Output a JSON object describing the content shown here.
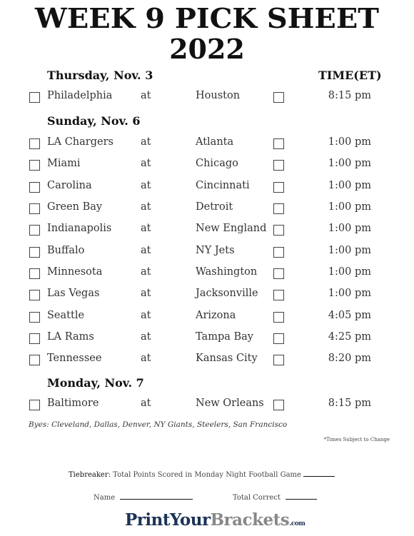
{
  "title": {
    "line1": "WEEK 9 PICK SHEET",
    "line2": "2022"
  },
  "time_header": "TIME(ET)",
  "at_label": "at",
  "days": [
    {
      "label": "Thursday, Nov. 3",
      "games": [
        {
          "away": "Philadelphia",
          "home": "Houston",
          "time": "8:15 pm"
        }
      ]
    },
    {
      "label": "Sunday, Nov. 6",
      "games": [
        {
          "away": "LA Chargers",
          "home": "Atlanta",
          "time": "1:00 pm"
        },
        {
          "away": "Miami",
          "home": "Chicago",
          "time": "1:00 pm"
        },
        {
          "away": "Carolina",
          "home": "Cincinnati",
          "time": "1:00 pm"
        },
        {
          "away": "Green Bay",
          "home": "Detroit",
          "time": "1:00 pm"
        },
        {
          "away": "Indianapolis",
          "home": "New England",
          "time": "1:00 pm"
        },
        {
          "away": "Buffalo",
          "home": "NY Jets",
          "time": "1:00 pm"
        },
        {
          "away": "Minnesota",
          "home": "Washington",
          "time": "1:00 pm"
        },
        {
          "away": "Las Vegas",
          "home": "Jacksonville",
          "time": "1:00 pm"
        },
        {
          "away": "Seattle",
          "home": "Arizona",
          "time": "4:05 pm"
        },
        {
          "away": "LA Rams",
          "home": "Tampa Bay",
          "time": "4:25 pm"
        },
        {
          "away": "Tennessee",
          "home": "Kansas City",
          "time": "8:20 pm"
        }
      ]
    },
    {
      "label": "Monday, Nov. 7",
      "games": [
        {
          "away": "Baltimore",
          "home": "New Orleans",
          "time": "8:15 pm"
        }
      ]
    }
  ],
  "byes": "Byes: Cleveland, Dallas, Denver, NY Giants, Steelers, San Francisco",
  "note": "*Times Subject to Change",
  "tiebreaker": {
    "label": "Tiebreaker:",
    "text": "Total Points Scored in Monday Night Football Game"
  },
  "name_label": "Name",
  "total_correct_label": "Total Correct",
  "logo": {
    "part1": "PrintYour",
    "part2": "Brackets",
    "suffix": ".com"
  }
}
